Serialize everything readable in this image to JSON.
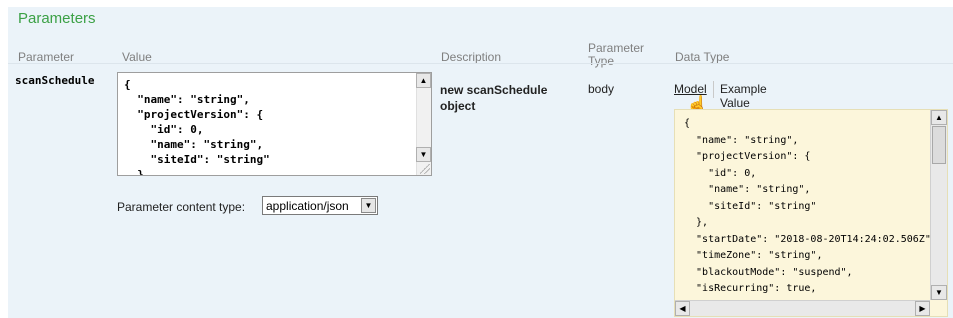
{
  "section": {
    "title": "Parameters"
  },
  "columns": {
    "parameter": "Parameter",
    "value": "Value",
    "description": "Description",
    "parameter_type_line1": "Parameter",
    "parameter_type_line2": "Type",
    "data_type": "Data Type"
  },
  "row": {
    "name": "scanSchedule",
    "value_text": "{\n  \"name\": \"string\",\n  \"projectVersion\": {\n    \"id\": 0,\n    \"name\": \"string\",\n    \"siteId\": \"string\"\n  },",
    "content_type_label": "Parameter content type:",
    "content_type_value": "application/json",
    "description_line1": "new scanSchedule",
    "description_line2": "object",
    "param_type": "body",
    "tabs": {
      "model": "Model",
      "example": "Example Value"
    },
    "model_json": "{\n  \"name\": \"string\",\n  \"projectVersion\": {\n    \"id\": 0,\n    \"name\": \"string\",\n    \"siteId\": \"string\"\n  },\n  \"startDate\": \"2018-08-20T14:24:02.506Z\",\n  \"timeZone\": \"string\",\n  \"blackoutMode\": \"suspend\",\n  \"isRecurring\": true,"
  },
  "colors": {
    "title": "#3ca146",
    "panel": "#ebf3f9",
    "model_bg": "#fcf6db"
  }
}
